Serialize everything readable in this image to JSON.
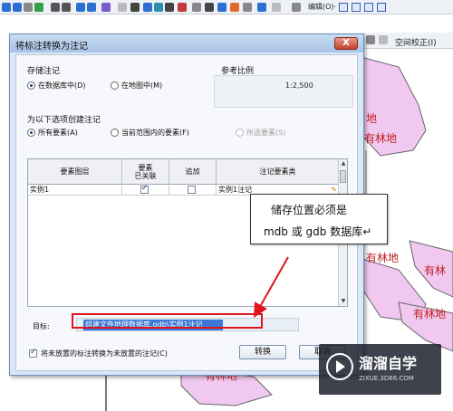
{
  "toolbar": {
    "edit_label": "编辑(O)·",
    "colors": [
      "#2b6fd0",
      "#e06a2a",
      "#33a04a",
      "#7a5bc8",
      "#c23a3a",
      "#2b8fb0"
    ]
  },
  "ribbon2": {
    "spatial_correction": "空间校正(I)"
  },
  "map": {
    "labels": [
      {
        "text": "地"
      },
      {
        "text": "有林地"
      },
      {
        "text": "有林地"
      },
      {
        "text": "有林"
      },
      {
        "text": "有林地"
      },
      {
        "text": "有林地"
      }
    ]
  },
  "dialog": {
    "title": "将标注转换为注记",
    "close_glyph": "X",
    "storage": {
      "title": "存储注记",
      "option_db": "在数据库中(D)",
      "option_map": "在地图中(M)",
      "selected": "option_db"
    },
    "ref_scale": {
      "title": "参考比例",
      "value": "1:2,500"
    },
    "create_for": {
      "title": "为以下选项创建注记",
      "option_all": "所有要素(A)",
      "option_extent": "当前范围内的要素(F)",
      "option_selected": "所选要素(S)",
      "selected": "option_all"
    },
    "table": {
      "headers": [
        "要素图层",
        "要素\n已关联",
        "追加",
        "注记要素类"
      ],
      "rows": [
        {
          "layer": "实例1",
          "linked": true,
          "append": false,
          "annotation_class": "实例1注记"
        }
      ]
    },
    "target": {
      "label": "目标:",
      "value": "组建文件地理数据库.gdb\\实例1注记"
    },
    "convert_unplaced": {
      "label": "将未放置的标注转换为未放置的注记(C)",
      "checked": true
    },
    "buttons": {
      "convert": "转换",
      "cancel": "取消"
    }
  },
  "note": {
    "line1": "储存位置必须是",
    "line2": "mdb 或 gdb 数据库↵"
  },
  "watermark": {
    "title": "溜溜自学",
    "subtitle": "ZIXUE.3D66.COM"
  }
}
